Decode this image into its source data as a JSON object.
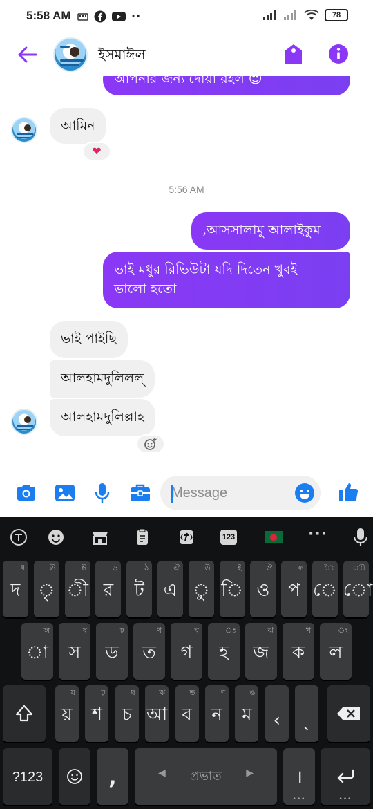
{
  "status_bar": {
    "time": "5:58 AM",
    "battery": "78"
  },
  "header": {
    "contact_name": "ইসমাঈল"
  },
  "messages": [
    {
      "id": "m0",
      "direction": "outgoing",
      "text": "আপনার জন্য দোয়া রইল 😍"
    },
    {
      "id": "m1",
      "direction": "incoming",
      "text": "আমিন",
      "reaction": "❤"
    },
    {
      "id": "m2",
      "direction": "outgoing",
      "text": ",আসসালামু আলাইকুম"
    },
    {
      "id": "m3",
      "direction": "outgoing",
      "text_line1": "ভাই মধুর রিভিউটা যদি দিতেন খুবই",
      "text_line2": "ভালো হতো"
    },
    {
      "id": "m4",
      "direction": "incoming",
      "text": "ভাই পাইছি"
    },
    {
      "id": "m5",
      "direction": "incoming",
      "text": "আলহামদুলিলল্"
    },
    {
      "id": "m6",
      "direction": "incoming",
      "text": "আলহামদুলিল্লাহ"
    }
  ],
  "timestamp": "5:56 AM",
  "composer": {
    "placeholder": "Message"
  },
  "keyboard": {
    "number_badge": "123",
    "row1": [
      {
        "main": "দ",
        "hint": "ধ"
      },
      {
        "main": "ৃ",
        "hint": "ঊ"
      },
      {
        "main": "ী",
        "hint": "ঈ"
      },
      {
        "main": "র",
        "hint": "ড়"
      },
      {
        "main": "ট",
        "hint": "ঠ"
      },
      {
        "main": "এ",
        "hint": "ঐ"
      },
      {
        "main": "ু",
        "hint": "উ"
      },
      {
        "main": "ি",
        "hint": "ই"
      },
      {
        "main": "ও",
        "hint": "ঔ"
      },
      {
        "main": "প",
        "hint": "ফ"
      },
      {
        "main": "ে",
        "hint": "ৈ"
      },
      {
        "main": "ো",
        "hint": "ৌ"
      }
    ],
    "row2": [
      {
        "main": "া",
        "hint": "অ"
      },
      {
        "main": "স",
        "hint": "ষ"
      },
      {
        "main": "ড",
        "hint": "ঢ"
      },
      {
        "main": "ত",
        "hint": "থ"
      },
      {
        "main": "গ",
        "hint": "ঘ"
      },
      {
        "main": "হ",
        "hint": "ঃ"
      },
      {
        "main": "জ",
        "hint": "ঝ"
      },
      {
        "main": "ক",
        "hint": "খ"
      },
      {
        "main": "ল",
        "hint": "ং"
      }
    ],
    "row3": [
      {
        "main": "য়",
        "hint": "য"
      },
      {
        "main": "শ",
        "hint": "ঢ়"
      },
      {
        "main": "চ",
        "hint": "ছ"
      },
      {
        "main": "আ",
        "hint": "ঋ"
      },
      {
        "main": "ব",
        "hint": "ভ"
      },
      {
        "main": "ন",
        "hint": "ণ"
      },
      {
        "main": "ম",
        "hint": "ঙ"
      },
      {
        "main": "‹",
        "hint": ""
      },
      {
        "main": "ˎ",
        "hint": ""
      }
    ],
    "symbols_key": "?123",
    "comma_key": ",",
    "space_label": "প্রভাত",
    "period_key": "।"
  }
}
